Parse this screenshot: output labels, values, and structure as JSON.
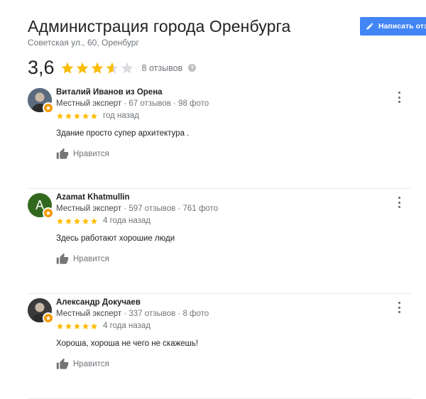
{
  "place": {
    "title": "Администрация города Оренбурга",
    "address": "Советская ул., 60, Оренбург"
  },
  "write_review_label": "Написать отзыв",
  "summary": {
    "rating": "3,6",
    "stars_value": 3.6,
    "count_label": "8 отзывов",
    "star_color": "#fbbc04",
    "star_empty_color": "#dadce0"
  },
  "reviews": [
    {
      "name": "Виталий Иванов из Орена",
      "level": "Местный эксперт",
      "stats": "67 отзывов · 98 фото",
      "stars": 5,
      "date": "год назад",
      "text": "Здание просто супер архитектура .",
      "like_label": "Нравится",
      "avatar_color": "#5a6b7d",
      "avatar_letter": ""
    },
    {
      "name": "Azamat Khatmullin",
      "level": "Местный эксперт",
      "stats": "597 отзывов · 761 фото",
      "stars": 5,
      "date": "4 года назад",
      "text": "Здесь работают хорошие люди",
      "like_label": "Нравится",
      "avatar_color": "#33691e",
      "avatar_letter": "A"
    },
    {
      "name": "Александр Докучаев",
      "level": "Местный эксперт",
      "stats": "337 отзывов · 8 фото",
      "stars": 5,
      "date": "4 года назад",
      "text": "Хороша, хороша не чего не скажешь!",
      "like_label": "Нравится",
      "avatar_color": "#3a3a3a",
      "avatar_letter": ""
    }
  ]
}
